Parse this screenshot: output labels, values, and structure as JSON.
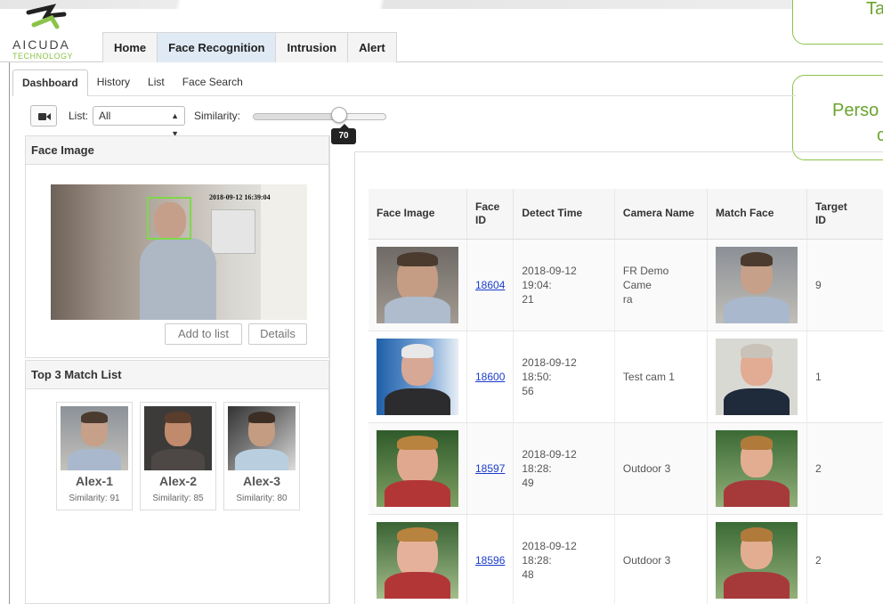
{
  "brand": {
    "name": "AICUDA",
    "sub": "TECHNOLOGY",
    "accent": "#8bc34a"
  },
  "topnav": [
    {
      "label": "Home",
      "active": false
    },
    {
      "label": "Face Recognition",
      "active": true
    },
    {
      "label": "Intrusion",
      "active": false
    },
    {
      "label": "Alert",
      "active": false
    }
  ],
  "callouts": {
    "first": "Ta",
    "second_line1": "Perso",
    "second_line2": "c"
  },
  "subtabs": [
    {
      "label": "Dashboard",
      "active": true
    },
    {
      "label": "History"
    },
    {
      "label": "List"
    },
    {
      "label": "Face Search"
    }
  ],
  "filter": {
    "camera_icon": "video-camera-icon",
    "list_label": "List:",
    "list_value": "All",
    "similarity_label": "Similarity:",
    "similarity_value": "70",
    "similarity_fraction": 0.7
  },
  "face_panel": {
    "title": "Face Image",
    "timestamp": "2018-09-12 16:39:04",
    "add_button": "Add to list",
    "details_button": "Details"
  },
  "match_panel": {
    "title": "Top 3 Match List",
    "items": [
      {
        "name": "Alex-1",
        "similarity": "Similarity: 91"
      },
      {
        "name": "Alex-2",
        "similarity": "Similarity: 85"
      },
      {
        "name": "Alex-3",
        "similarity": "Similarity: 80"
      }
    ]
  },
  "table": {
    "headers": {
      "face_image": "Face Image",
      "face_id_1": "Face",
      "face_id_2": "ID",
      "detect_time": "Detect Time",
      "camera_name": "Camera Name",
      "match_face": "Match Face",
      "target_id_1": "Target",
      "target_id_2": "ID"
    },
    "rows": [
      {
        "face_id": "18604",
        "time_1": "2018-09-12 19:04:",
        "time_2": "21",
        "camera_1": "FR Demo Came",
        "camera_2": "ra",
        "target_id": "9"
      },
      {
        "face_id": "18600",
        "time_1": "2018-09-12 18:50:",
        "time_2": "56",
        "camera_1": "Test cam 1",
        "camera_2": "",
        "target_id": "1"
      },
      {
        "face_id": "18597",
        "time_1": "2018-09-12 18:28:",
        "time_2": "49",
        "camera_1": "Outdoor 3",
        "camera_2": "",
        "target_id": "2"
      },
      {
        "face_id": "18596",
        "time_1": "2018-09-12 18:28:",
        "time_2": "48",
        "camera_1": "Outdoor 3",
        "camera_2": "",
        "target_id": "2"
      }
    ]
  }
}
